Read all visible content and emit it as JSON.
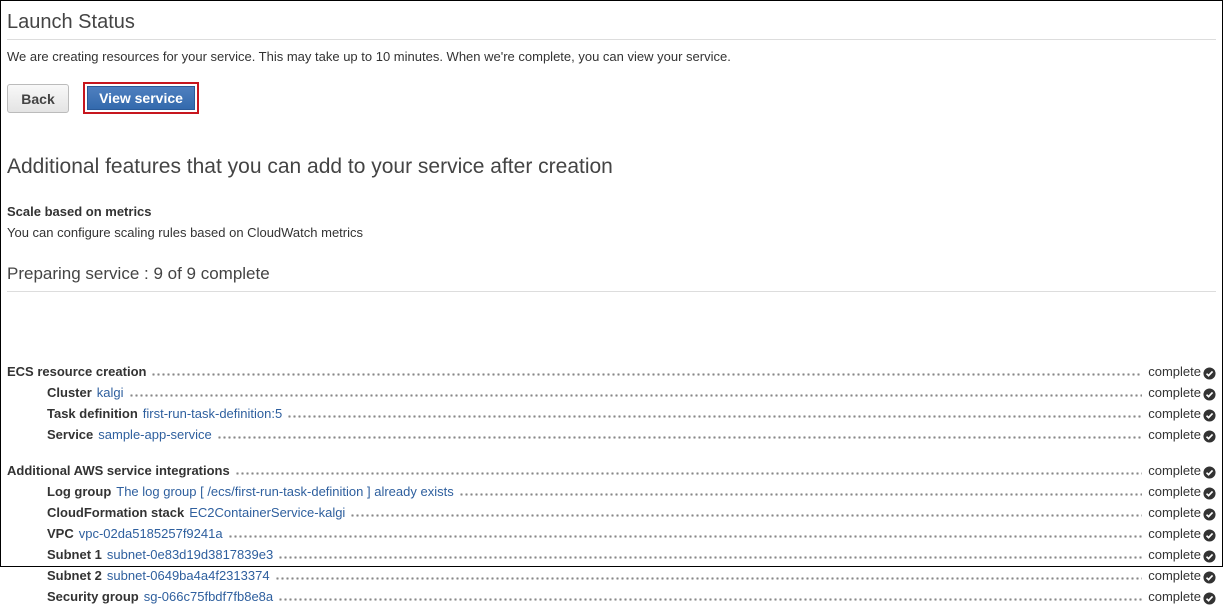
{
  "launch": {
    "title": "Launch Status",
    "intro": "We are creating resources for your service. This may take up to 10 minutes. When we're complete, you can view your service.",
    "back_label": "Back",
    "view_label": "View service"
  },
  "features": {
    "title": "Additional features that you can add to your service after creation",
    "item_name": "Scale based on metrics",
    "item_desc": "You can configure scaling rules based on CloudWatch metrics"
  },
  "preparing": {
    "title": "Preparing service : 9 of 9 complete"
  },
  "steps": [
    {
      "label": "ECS resource creation",
      "value": "",
      "status": "complete"
    },
    {
      "label": "Cluster",
      "value": "kalgi",
      "status": "complete"
    },
    {
      "label": "Task definition",
      "value": "first-run-task-definition:5",
      "status": "complete"
    },
    {
      "label": "Service",
      "value": "sample-app-service",
      "status": "complete"
    },
    {
      "label": "Additional AWS service integrations",
      "value": "",
      "status": "complete"
    },
    {
      "label": "Log group",
      "value": "The log group [ /ecs/first-run-task-definition ] already exists",
      "status": "complete"
    },
    {
      "label": "CloudFormation stack",
      "value": "EC2ContainerService-kalgi",
      "status": "complete"
    },
    {
      "label": "VPC",
      "value": "vpc-02da5185257f9241a",
      "status": "complete"
    },
    {
      "label": "Subnet 1",
      "value": "subnet-0e83d19d3817839e3",
      "status": "complete"
    },
    {
      "label": "Subnet 2",
      "value": "subnet-0649ba4a4f2313374",
      "status": "complete"
    },
    {
      "label": "Security group",
      "value": "sg-066c75fbdf7fb8e8a",
      "status": "complete"
    }
  ],
  "colors": {
    "link": "#2e5f9e",
    "primary_button": "#336aad",
    "highlight_border": "#c7161e",
    "check": "#333333"
  },
  "icons": {
    "status": "check-circle-icon"
  }
}
